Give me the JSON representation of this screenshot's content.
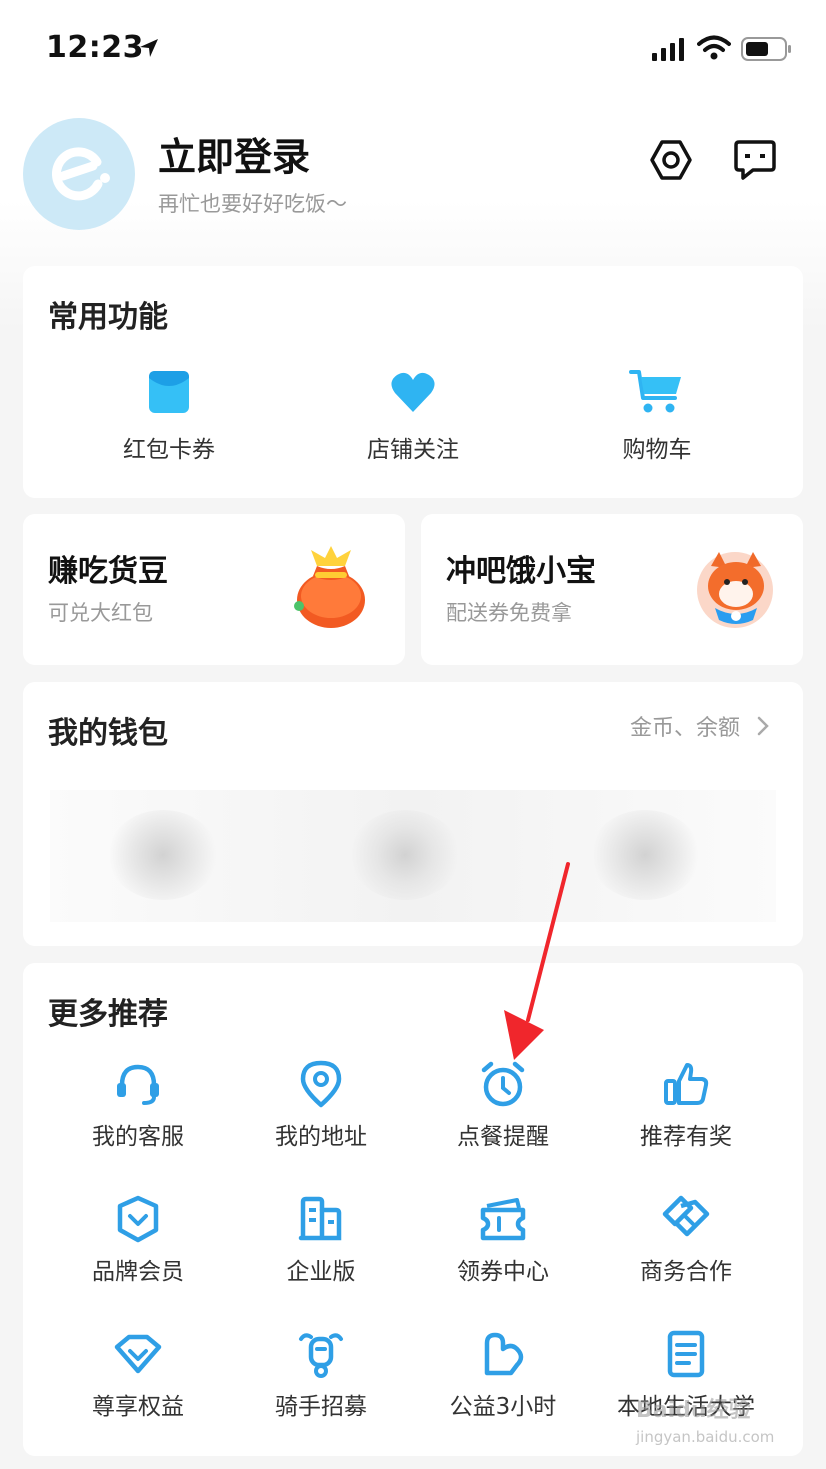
{
  "status_bar": {
    "time": "12:23"
  },
  "header": {
    "title": "立即登录",
    "subtitle": "再忙也要好好吃饭～"
  },
  "common": {
    "title": "常用功能",
    "items": [
      {
        "label": "红包卡券",
        "icon": "red-packet-icon"
      },
      {
        "label": "店铺关注",
        "icon": "heart-icon"
      },
      {
        "label": "购物车",
        "icon": "shopping-cart-icon"
      }
    ]
  },
  "promos": [
    {
      "title": "赚吃货豆",
      "subtitle": "可兑大红包",
      "icon": "lucky-bag-icon"
    },
    {
      "title": "冲吧饿小宝",
      "subtitle": "配送券免费拿",
      "icon": "shiba-mascot-icon"
    }
  ],
  "wallet": {
    "title": "我的钱包",
    "link": "金币、余额"
  },
  "more": {
    "title": "更多推荐",
    "items": [
      {
        "label": "我的客服",
        "icon": "headset-icon"
      },
      {
        "label": "我的地址",
        "icon": "location-pin-icon"
      },
      {
        "label": "点餐提醒",
        "icon": "alarm-clock-icon"
      },
      {
        "label": "推荐有奖",
        "icon": "thumbs-up-icon"
      },
      {
        "label": "品牌会员",
        "icon": "shield-chevron-icon"
      },
      {
        "label": "企业版",
        "icon": "building-icon"
      },
      {
        "label": "领券中心",
        "icon": "coupon-icon"
      },
      {
        "label": "商务合作",
        "icon": "handshake-icon"
      },
      {
        "label": "尊享权益",
        "icon": "diamond-icon"
      },
      {
        "label": "骑手招募",
        "icon": "rider-scooter-icon"
      },
      {
        "label": "公益3小时",
        "icon": "charity-hand-icon"
      },
      {
        "label": "本地生活大学",
        "icon": "document-icon"
      }
    ]
  },
  "watermark": {
    "text": "Baidu经验",
    "sub": "jingyan.baidu.com"
  },
  "colors": {
    "accent": "#1e9be8",
    "icon_blue": "#2f9fe6",
    "annotation_red": "#f0262c"
  }
}
